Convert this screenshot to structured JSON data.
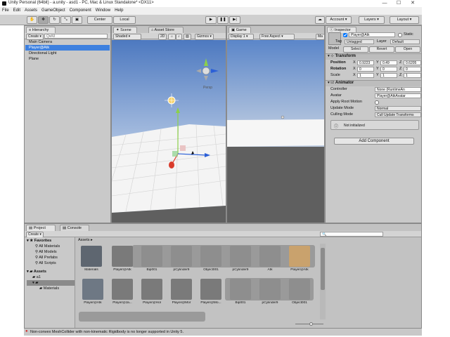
{
  "window": {
    "title": "Unity Personal (64bit) - a.unity - asd1 - PC, Mac & Linux Standalone* <DX11>",
    "min": "—",
    "max": "☐",
    "close": "✕"
  },
  "menu": [
    "File",
    "Edit",
    "Assets",
    "GameObject",
    "Component",
    "Window",
    "Help"
  ],
  "toolbar": {
    "pivot": "Center",
    "space": "Local",
    "account": "Account",
    "layers": "Layers",
    "layout": "Layout"
  },
  "hierarchy": {
    "tab": "Hierarchy",
    "create": "Create",
    "search_placeholder": "Q▾All",
    "items": [
      "Main Camera",
      "Player@Atk",
      "Directional Light",
      "Plane"
    ]
  },
  "scene": {
    "tab": "Scene",
    "tab2": "Asset Store",
    "shading": "Shaded",
    "mode2d": "2D",
    "gizmos": "Gizmos",
    "persp": "Persp"
  },
  "game": {
    "tab": "Game",
    "display": "Display 1",
    "aspect": "Free Aspect",
    "extra": "Ma"
  },
  "inspector": {
    "tab": "Inspector",
    "object_name": "Player@Atk",
    "static": "Static",
    "tag_label": "Tag",
    "tag": "Untagged",
    "layer_label": "Layer",
    "layer": "Default",
    "model_btn": "Model",
    "select_btn": "Select",
    "revert_btn": "Revert",
    "open_btn": "Open",
    "transform": "Transform",
    "position_label": "Position",
    "rotation_label": "Rotation",
    "scale_label": "Scale",
    "position": {
      "x": "0.9223",
      "y": "0.49",
      "z": "0.6205"
    },
    "rotation": {
      "x": "0",
      "y": "0",
      "z": "0"
    },
    "scale": {
      "x": "1",
      "y": "1",
      "z": "1"
    },
    "animator": "Animator",
    "controller_label": "Controller",
    "controller": "None (RuntimeAn",
    "avatar_label": "Avatar",
    "avatar": "Player@AtkAvatar",
    "root_motion_label": "Apply Root Motion",
    "update_mode_label": "Update Mode",
    "update_mode": "Normal",
    "culling_label": "Culling Mode",
    "culling": "Cull Update Transforms",
    "info": "Not initialized",
    "add_component": "Add Component"
  },
  "project": {
    "tab": "Project",
    "tab2": "Console",
    "create": "Create",
    "favorites": "Favorites",
    "fav_items": [
      "All Materials",
      "All Models",
      "All Prefabs",
      "All Scripts"
    ],
    "assets": "Assets",
    "asset_items": [
      "a1",
      "",
      "Materials"
    ],
    "breadcrumb": "Assets ▸ ",
    "row1": [
      "Materials",
      "Player@Atk",
      "Bip001",
      "pCylinder9",
      "Object001",
      "pCylinder9",
      "Atk",
      "Player@Atk"
    ],
    "row2": [
      "Player@Atk",
      "Player@Ja...",
      "Player@Hol",
      "Player@Mor",
      "Player@Mo...",
      "Bip001",
      "pCylinder9",
      "Object001"
    ]
  },
  "status": {
    "message": "Non-convex MeshCollider with non-kinematic Rigidbody is no longer supported in Unity 5."
  },
  "colors": {
    "selection": "#3d80df",
    "sky": "#6b8fc4",
    "ground": "#5f5f5f",
    "error": "#d22c2c"
  }
}
